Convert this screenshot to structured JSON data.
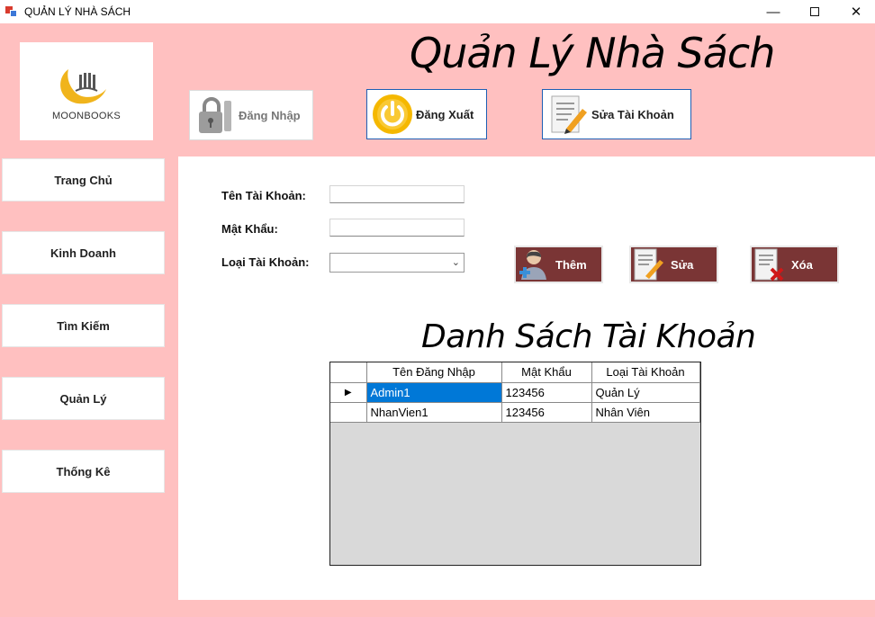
{
  "window": {
    "title": "QUẢN LÝ NHÀ SÁCH",
    "minimize": "—",
    "close": "✕"
  },
  "logo": {
    "text": "MOONBOOKS"
  },
  "header": {
    "title": "Quản Lý Nhà Sách"
  },
  "top_buttons": {
    "login": "Đăng Nhập",
    "logout": "Đăng Xuất",
    "edit_account": "Sửa Tài Khoản"
  },
  "sidebar": {
    "items": [
      {
        "label": "Trang Chủ"
      },
      {
        "label": "Kinh Doanh"
      },
      {
        "label": "Tìm Kiếm"
      },
      {
        "label": "Quản Lý"
      },
      {
        "label": "Thống Kê"
      }
    ]
  },
  "form": {
    "username_label": "Tên Tài Khoản:",
    "username_value": "",
    "password_label": "Mật Khẩu:",
    "password_value": "",
    "account_type_label": "Loại Tài Khoản:",
    "account_type_value": ""
  },
  "actions": {
    "add": "Thêm",
    "edit": "Sửa",
    "delete": "Xóa"
  },
  "list": {
    "title": "Danh Sách Tài Khoản",
    "columns": [
      "Tên Đăng Nhập",
      "Mật Khẩu",
      "Loại Tài Khoản"
    ],
    "rows": [
      [
        "Admin1",
        "123456",
        "Quản Lý"
      ],
      [
        "NhanVien1",
        "123456",
        "Nhân Viên"
      ]
    ],
    "current_row_marker": "▶"
  },
  "colors": {
    "background": "#ffc0c0",
    "action_button": "#7a3535",
    "selection": "#0078d7",
    "button_border": "#1e5fb4"
  }
}
